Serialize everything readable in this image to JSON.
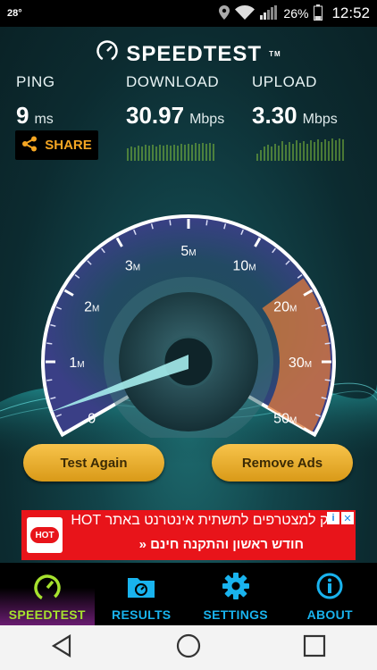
{
  "status_bar": {
    "temperature": "28°",
    "battery": "26%",
    "time": "12:52"
  },
  "app": {
    "brand": "SPEEDTEST",
    "trademark": "TM"
  },
  "metrics": {
    "ping": {
      "label": "PING",
      "value": "9",
      "unit": "ms"
    },
    "download": {
      "label": "DOWNLOAD",
      "value": "30.97",
      "unit": "Mbps"
    },
    "upload": {
      "label": "UPLOAD",
      "value": "3.30",
      "unit": "Mbps"
    }
  },
  "share": {
    "label": "SHARE"
  },
  "gauge": {
    "ticks": [
      {
        "value": "0",
        "unit": ""
      },
      {
        "value": "1",
        "unit": "M"
      },
      {
        "value": "2",
        "unit": "M"
      },
      {
        "value": "3",
        "unit": "M"
      },
      {
        "value": "5",
        "unit": "M"
      },
      {
        "value": "10",
        "unit": "M"
      },
      {
        "value": "20",
        "unit": "M"
      },
      {
        "value": "30",
        "unit": "M"
      },
      {
        "value": "50",
        "unit": "M"
      }
    ],
    "colors": {
      "ring": "#6a5fc9",
      "highlight": "#e07b39",
      "needle": "#9ce4e6"
    }
  },
  "buttons": {
    "test_again": "Test Again",
    "remove_ads": "Remove Ads"
  },
  "ad": {
    "logo": "HOT",
    "line1": "רק למצטרפים לתשתית אינטרנט באתר HOT",
    "line2": "חודש ראשון והתקנה חינם «"
  },
  "nav": {
    "speedtest": "SPEEDTEST",
    "results": "RESULTS",
    "settings": "SETTINGS",
    "about": "ABOUT"
  }
}
